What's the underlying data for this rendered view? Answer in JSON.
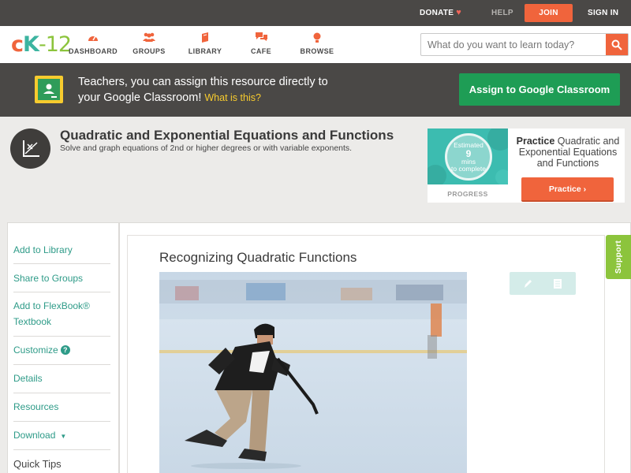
{
  "topbar": {
    "donate": "DONATE",
    "help": "HELP",
    "join": "JOIN",
    "signin": "SIGN IN"
  },
  "logo": {
    "c": "c",
    "k": "K",
    "n": "-12"
  },
  "nav": [
    {
      "label": "DASHBOARD",
      "icon": "dashboard-icon"
    },
    {
      "label": "GROUPS",
      "icon": "groups-icon"
    },
    {
      "label": "LIBRARY",
      "icon": "library-icon"
    },
    {
      "label": "CAFE",
      "icon": "cafe-icon"
    },
    {
      "label": "BROWSE",
      "icon": "browse-icon"
    }
  ],
  "search": {
    "placeholder": "What do you want to learn today?"
  },
  "classroom": {
    "line1": "Teachers, you can assign this resource directly to",
    "line2": "your Google Classroom!",
    "what": "What is this?",
    "button": "Assign to Google Classroom"
  },
  "concept": {
    "title": "Quadratic and Exponential Equations and Functions",
    "subtitle": "Solve and graph equations of 2nd or higher degrees or with variable exponents."
  },
  "practice": {
    "estimated": "Estimated",
    "mins": "9",
    "mins_label": "mins",
    "to_complete": "to complete",
    "progress": "PROGRESS",
    "bold": "Practice",
    "text": "Quadratic and Exponential Equations and Functions",
    "button": "Practice"
  },
  "sidebar": {
    "items": [
      {
        "label": "Add to Library"
      },
      {
        "label": "Share to Groups"
      },
      {
        "label": "Add to FlexBook® Textbook"
      },
      {
        "label": "Customize"
      },
      {
        "label": "Details"
      },
      {
        "label": "Resources"
      },
      {
        "label": "Download"
      }
    ],
    "quick_tips": "Quick Tips"
  },
  "lesson": {
    "title": "Recognizing Quadratic Functions"
  },
  "support": "Support",
  "colors": {
    "brand_orange": "#f0643c",
    "teal": "#2e9b88",
    "green": "#1e9d55",
    "dark_bar": "#4a4846",
    "support_green": "#8cc43c"
  }
}
